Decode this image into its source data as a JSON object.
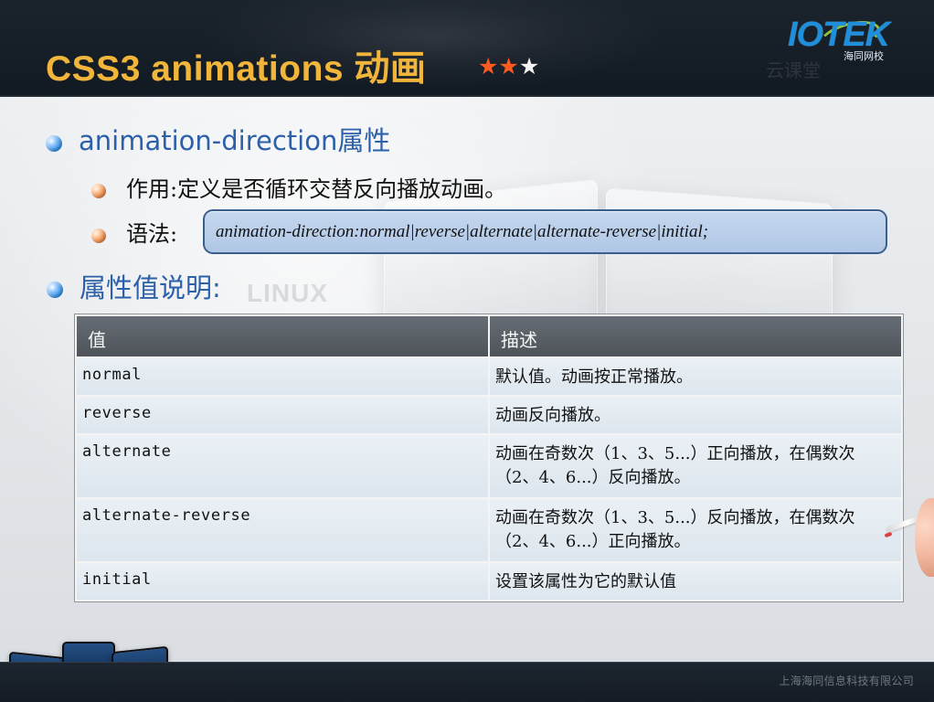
{
  "slide": {
    "title": "CSS3 animations 动画",
    "stars_filled": "★★",
    "stars_empty": "★",
    "logo_text": "IOTEK",
    "logo_subtitle": "海同网校",
    "watermark_text": "云课堂",
    "bg_text": "LINUX",
    "footer_text": "上海海同信息科技有限公司"
  },
  "content": {
    "heading": "animation-direction属性",
    "purpose": "作用:定义是否循环交替反向播放动画。",
    "syntax_label": "语法:",
    "syntax_code": "animation-direction:normal|reverse|alternate|alternate-reverse|initial;",
    "values_heading": "属性值说明:"
  },
  "table": {
    "headers": [
      "值",
      "描述"
    ],
    "rows": [
      {
        "value": "normal",
        "description": "默认值。动画按正常播放。"
      },
      {
        "value": "reverse",
        "description": "动画反向播放。"
      },
      {
        "value": "alternate",
        "description": "动画在奇数次（1、3、5...）正向播放，在偶数次（2、4、6...）反向播放。"
      },
      {
        "value": "alternate-reverse",
        "description": "动画在奇数次（1、3、5...）反向播放，在偶数次（2、4、6...）正向播放。"
      },
      {
        "value": "initial",
        "description": "设置该属性为它的默认值"
      }
    ]
  },
  "icons": {
    "bullet_primary": "blue-bullet-icon",
    "bullet_secondary": "orange-bullet-icon",
    "star": "star-icon"
  },
  "colors": {
    "title": "#f0b53a",
    "header_background": "#1b232d",
    "heading_text": "#2c60a8",
    "syntax_box": "#c5d7ef",
    "table_header": "#5f666d"
  }
}
